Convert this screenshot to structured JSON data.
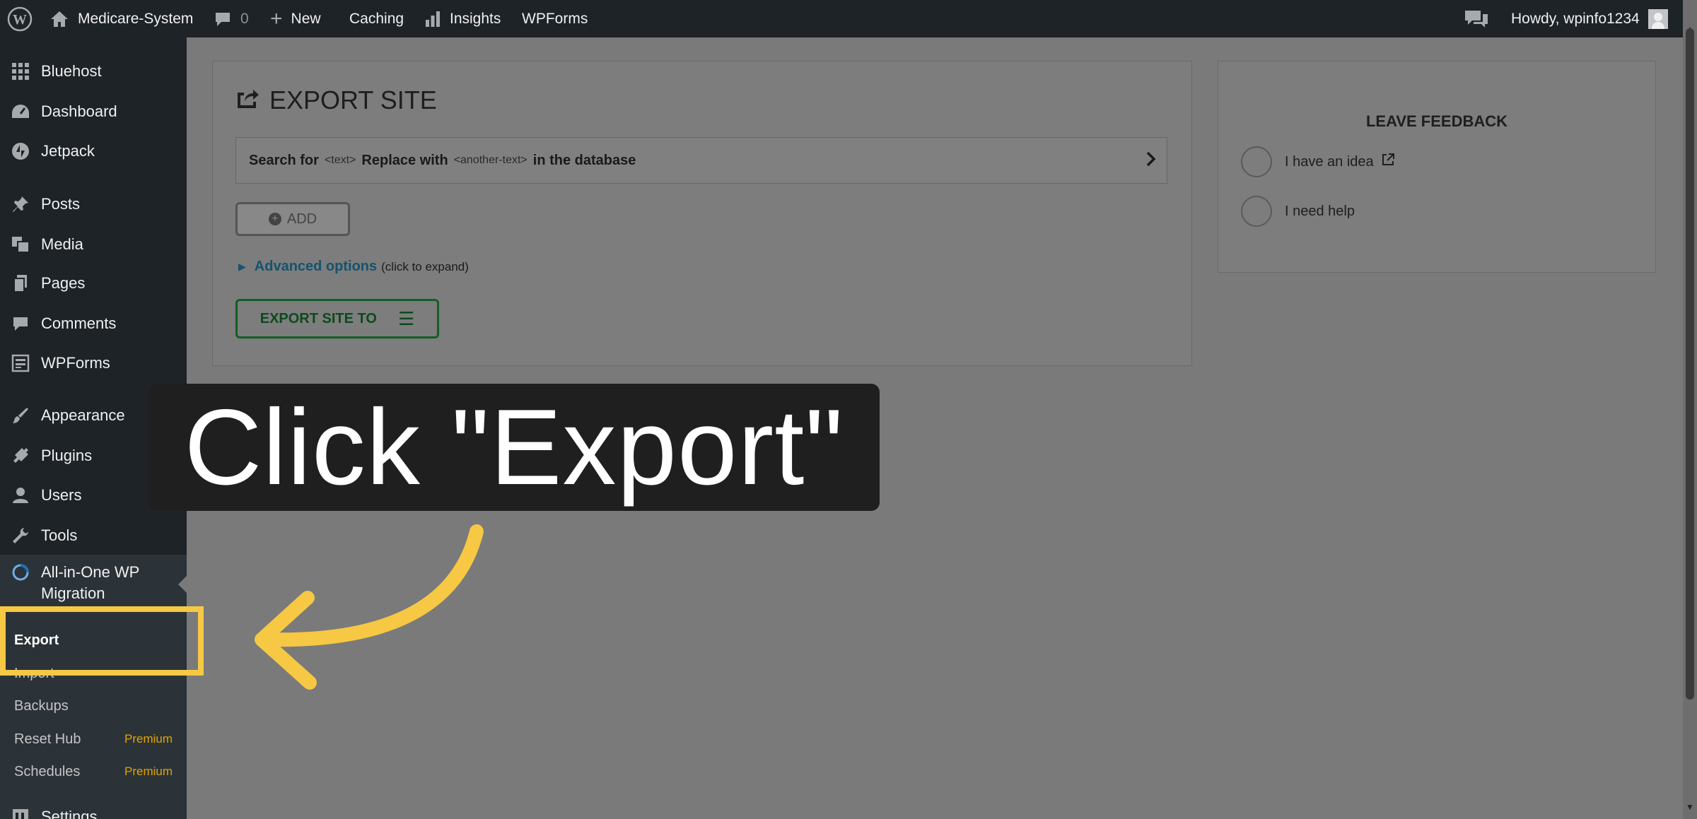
{
  "admin_bar": {
    "site_name": "Medicare-System",
    "comments_count": "0",
    "new_label": "New",
    "caching_label": "Caching",
    "insights_label": "Insights",
    "wpforms_label": "WPForms",
    "howdy": "Howdy, wpinfo1234"
  },
  "sidebar": {
    "items": [
      {
        "label": "Bluehost",
        "icon": "grid-icon"
      },
      {
        "label": "Dashboard",
        "icon": "dashboard-icon"
      },
      {
        "label": "Jetpack",
        "icon": "jetpack-icon"
      },
      {
        "label": "Posts",
        "icon": "pin-icon"
      },
      {
        "label": "Media",
        "icon": "media-icon"
      },
      {
        "label": "Pages",
        "icon": "pages-icon"
      },
      {
        "label": "Comments",
        "icon": "comment-icon"
      },
      {
        "label": "WPForms",
        "icon": "form-icon"
      },
      {
        "label": "Appearance",
        "icon": "brush-icon"
      },
      {
        "label": "Plugins",
        "icon": "plug-icon"
      },
      {
        "label": "Users",
        "icon": "user-icon"
      },
      {
        "label": "Tools",
        "icon": "wrench-icon"
      },
      {
        "label": "All-in-One WP Migration",
        "icon": "migration-icon"
      },
      {
        "label": "Settings",
        "icon": "settings-icon"
      }
    ],
    "submenu": {
      "export": "Export",
      "import": "Import",
      "backups": "Backups",
      "reset_hub": "Reset Hub",
      "schedules": "Schedules",
      "premium_label": "Premium"
    }
  },
  "export_panel": {
    "title": "EXPORT SITE",
    "search_for": "Search for",
    "text_token": "<text>",
    "replace_with": "Replace with",
    "another_token": "<another-text>",
    "in_database": "in the database",
    "add_label": "ADD",
    "advanced_link": "Advanced options",
    "advanced_hint": "(click to expand)",
    "export_to_label": "EXPORT SITE TO"
  },
  "feedback_panel": {
    "title": "LEAVE FEEDBACK",
    "idea": "I have an idea",
    "help": "I need help"
  },
  "overlay": {
    "callout_text": "Click \"Export\"",
    "highlight_color": "#f6c844",
    "arrow_color": "#f6c844"
  },
  "colors": {
    "admin_bar_bg": "#1d2327",
    "submenu_bg": "#2c3338",
    "premium": "#e0a400",
    "link": "#15536e",
    "export_button": "#125e26"
  }
}
